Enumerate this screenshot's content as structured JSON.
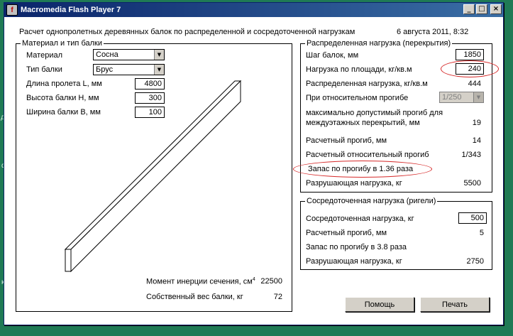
{
  "desktop": {
    "left_marks": [
      "д",
      "d",
      "к"
    ]
  },
  "window": {
    "title": "Macromedia Flash Player 7",
    "minimize": "_",
    "maximize": "□",
    "close": "×"
  },
  "header": {
    "title": "Расчет однопролетных деревянных балок по распределенной и сосредоточенной нагрузкам",
    "datetime": "6 августа 2011, 8:32"
  },
  "material_group": {
    "legend": "Материал и тип балки",
    "material_label": "Материал",
    "material_value": "Сосна",
    "beam_type_label": "Тип балки",
    "beam_type_value": "Брус",
    "span_label": "Длина пролета L, мм",
    "span_value": "4800",
    "height_label": "Высота балки H, мм",
    "height_value": "300",
    "width_label": "Ширина балки B, мм",
    "width_value": "100",
    "inertia_label": "Момент инерции сечения, см",
    "inertia_sup": "4",
    "inertia_value": "22500",
    "weight_label": "Собственный вес балки, кг",
    "weight_value": "72"
  },
  "distributed_group": {
    "legend": "Распределенная нагрузка (перекрытия)",
    "step_label": "Шаг балок, мм",
    "step_value": "1850",
    "area_load_label": "Нагрузка по площади, кг/кв.м",
    "area_load_value": "240",
    "dist_load_label": "Распределенная нагрузка, кг/кв.м",
    "dist_load_value": "444",
    "rel_deflection_label": "При относительном прогибе",
    "rel_deflection_value": "1/250",
    "max_deflection_label_1": "максимально допустимый прогиб для",
    "max_deflection_label_2": "междуэтажных перекрытий, мм",
    "max_deflection_value": "19",
    "calc_deflection_label": "Расчетный прогиб, мм",
    "calc_deflection_value": "14",
    "calc_rel_label": "Расчетный относительный прогиб",
    "calc_rel_value": "1/343",
    "margin_text": "Запас по прогибу в 1.36 раза",
    "breaking_label": "Разрушающая нагрузка, кг",
    "breaking_value": "5500"
  },
  "point_group": {
    "legend": "Сосредоточенная нагрузка (ригели)",
    "point_load_label": "Сосредоточенная нагрузка, кг",
    "point_load_value": "500",
    "deflection_label": "Расчетный прогиб, мм",
    "deflection_value": "5",
    "margin_text": "Запас по прогибу в 3.8 раза",
    "breaking_label": "Разрушающая нагрузка, кг",
    "breaking_value": "2750"
  },
  "buttons": {
    "help": "Помощь",
    "print": "Печать"
  },
  "colors": {
    "annotation": "#d62a2a",
    "titlebar": "#0a246a",
    "desktop": "#1f7a55"
  }
}
